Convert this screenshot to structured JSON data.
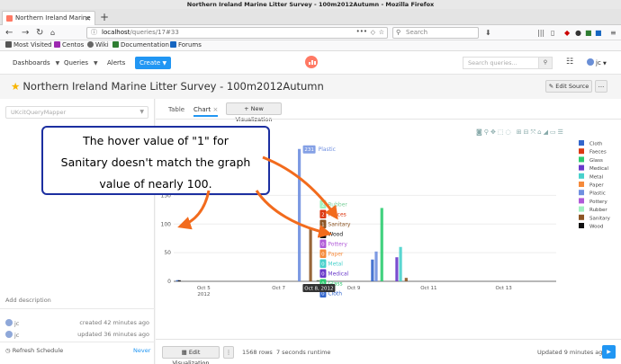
{
  "window": {
    "title": "Northern Ireland Marine Litter Survey - 100m2012Autumn - Mozilla Firefox"
  },
  "browser": {
    "tab_title": "Northern Ireland Marine",
    "url_host": "localhost",
    "url_path": "/queries/17#33",
    "search_placeholder": "Search",
    "bookmarks": [
      {
        "label": "Most Visited",
        "icon": "gear-icon",
        "color": "#555555"
      },
      {
        "label": "Centos",
        "icon": "centos-icon",
        "color": "#9c27b0"
      },
      {
        "label": "Wiki",
        "icon": "wiki-icon",
        "color": "#666666"
      },
      {
        "label": "Documentation",
        "icon": "doc-icon",
        "color": "#2e7d32"
      },
      {
        "label": "Forums",
        "icon": "forum-icon",
        "color": "#1565c0"
      }
    ]
  },
  "app": {
    "nav": {
      "dashboards": "Dashboards",
      "queries": "Queries",
      "alerts": "Alerts",
      "create": "Create"
    },
    "search_placeholder": "Search queries...",
    "user": "jc",
    "accent": "#2196f3",
    "logo_color": "#ff7964"
  },
  "query": {
    "title": "Northern Ireland Marine Litter Survey - 100m2012Autumn",
    "edit_source": "Edit Source",
    "more": "...",
    "datasource_placeholder": "UKcitQueryMapper",
    "add_description": "Add description",
    "created": {
      "user": "jc",
      "text": "created 42 minutes ago"
    },
    "updated": {
      "user": "jc",
      "text": "updated 36 minutes ago"
    },
    "refresh_label": "Refresh Schedule",
    "refresh_value": "Never"
  },
  "viz": {
    "tabs": [
      "Table",
      "Chart"
    ],
    "active_tab": "Chart",
    "new_vis": "+ New Visualization",
    "edit_vis": "Edit Visualization",
    "rows": "1568 rows",
    "runtime": "7 seconds runtime",
    "updated": "Updated 9 minutes ago"
  },
  "chart_data": {
    "type": "bar",
    "y_ticks": [
      0,
      50,
      100,
      150
    ],
    "ylim": [
      0,
      240
    ],
    "x_ticks": [
      {
        "label": "Oct 5",
        "sub": "2012",
        "day": 5
      },
      {
        "label": "Oct 7",
        "sub": "",
        "day": 7
      },
      {
        "label": "Oct 9",
        "sub": "",
        "day": 9
      },
      {
        "label": "Oct 11",
        "sub": "",
        "day": 11
      },
      {
        "label": "Oct 13",
        "sub": "",
        "day": 13
      }
    ],
    "xlim_days": [
      4.2,
      14.4
    ],
    "legend_position": "right",
    "series": [
      {
        "name": "Cloth",
        "color": "#3366cc",
        "points": [
          [
            4.3,
            2
          ],
          [
            8.05,
            0
          ],
          [
            9.5,
            38
          ]
        ]
      },
      {
        "name": "Faeces",
        "color": "#dc3912",
        "points": [
          [
            8.05,
            2
          ]
        ]
      },
      {
        "name": "Glass",
        "color": "#2ecc71",
        "points": [
          [
            8.05,
            0
          ],
          [
            9.75,
            128
          ]
        ]
      },
      {
        "name": "Medical",
        "color": "#6a3acb",
        "points": [
          [
            8.05,
            0
          ],
          [
            10.15,
            42
          ]
        ]
      },
      {
        "name": "Metal",
        "color": "#48d1cc",
        "points": [
          [
            8.05,
            0
          ],
          [
            10.25,
            60
          ]
        ]
      },
      {
        "name": "Paper",
        "color": "#f58a3b",
        "points": [
          [
            8.05,
            0
          ]
        ]
      },
      {
        "name": "Plastic",
        "color": "#6f8fe0",
        "points": [
          [
            7.55,
            231
          ],
          [
            9.6,
            52
          ]
        ]
      },
      {
        "name": "Pottery",
        "color": "#b05ad8",
        "points": [
          [
            8.05,
            0
          ]
        ]
      },
      {
        "name": "Rubber",
        "color": "#a0f0c0",
        "points": [
          [
            8.05,
            2
          ]
        ]
      },
      {
        "name": "Sanitary",
        "color": "#8d5524",
        "points": [
          [
            7.85,
            92
          ],
          [
            10.4,
            6
          ]
        ]
      },
      {
        "name": "Wood",
        "color": "#111111",
        "points": [
          [
            4.35,
            1
          ],
          [
            8.05,
            0
          ]
        ]
      }
    ],
    "hover": {
      "x_label": "Oct 8, 2012",
      "plastic_value": "231",
      "plastic_label": "Plastic",
      "entries": [
        {
          "value": "2",
          "name": "Rubber",
          "color": "#a0f0c0"
        },
        {
          "value": "2",
          "name": "Faeces",
          "color": "#dc3912"
        },
        {
          "value": "1",
          "name": "Sanitary",
          "color": "#8d5524"
        },
        {
          "value": "0",
          "name": "Wood",
          "color": "#111111"
        },
        {
          "value": "0",
          "name": "Pottery",
          "color": "#b05ad8"
        },
        {
          "value": "0",
          "name": "Paper",
          "color": "#f58a3b"
        },
        {
          "value": "0",
          "name": "Metal",
          "color": "#48d1cc"
        },
        {
          "value": "0",
          "name": "Medical",
          "color": "#6a3acb"
        },
        {
          "value": "0",
          "name": "Glass",
          "color": "#2ecc71"
        },
        {
          "value": "0",
          "name": "Cloth",
          "color": "#3366cc"
        }
      ]
    }
  },
  "annotation": {
    "lines": [
      "The hover value of \"1\" for",
      "Sanitary doesn't match the graph",
      "value of nearly 100."
    ],
    "border_color": "#1c2fa0",
    "arrow_color": "#f26b1d"
  }
}
